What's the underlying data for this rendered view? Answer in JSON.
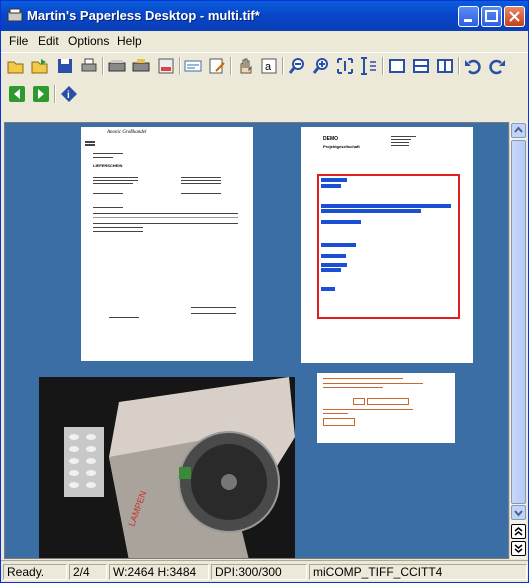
{
  "window": {
    "title": "Martin's Paperless Desktop - multi.tif*"
  },
  "menu": [
    "File",
    "Edit",
    "Options",
    "Help"
  ],
  "toolbar_icons": [
    "open-folder-icon",
    "open-icon",
    "save-icon",
    "print-icon",
    "scan-icon",
    "scan-multi-icon",
    "fax-icon",
    "form-icon",
    "edit-icon",
    "hand-icon",
    "text-select-icon",
    "zoom-out-icon",
    "zoom-in-icon",
    "fit-width-icon",
    "fit-height-icon",
    "single-page-icon",
    "split-horizontal-icon",
    "split-vertical-icon",
    "undo-icon",
    "redo-icon"
  ],
  "nav_icons": [
    "back-icon",
    "forward-icon",
    "info-icon"
  ],
  "status": {
    "state": "Ready.",
    "page": "2/4",
    "dims": "W:2464 H:3484",
    "dpi": "DPI:300/300",
    "compression": "miCOMP_TIFF_CCITT4"
  },
  "doc1": {
    "heading": "Anonic Großhandel",
    "label": "LIEFERSCHEIN"
  },
  "doc2": {
    "heading": "DEMO",
    "subheading": "Projektgesellschaft"
  },
  "colors": {
    "workspace": "#3a6ea5",
    "selection": "#e02020",
    "highlight": "#1a4fd6"
  }
}
